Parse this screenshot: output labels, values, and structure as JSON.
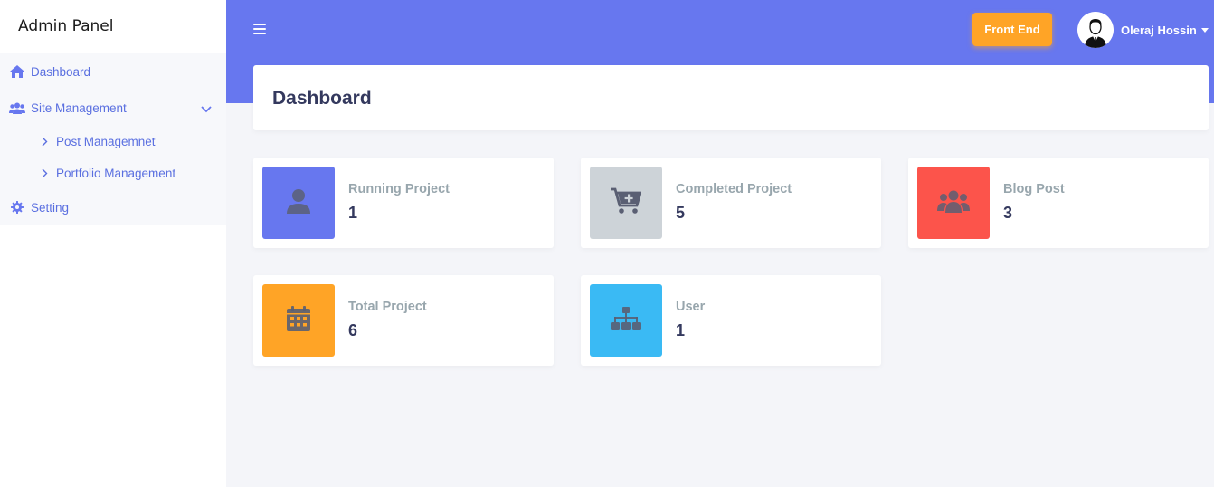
{
  "sidebar": {
    "brand": "Admin Panel",
    "items": [
      {
        "label": "Dashboard",
        "icon": "home-icon"
      },
      {
        "label": "Site Management",
        "icon": "users-icon"
      },
      {
        "label": "Setting",
        "icon": "gear-icon"
      }
    ],
    "subitems": [
      {
        "label": "Post Managemnet"
      },
      {
        "label": "Portfolio Management"
      }
    ]
  },
  "topbar": {
    "frontend_label": "Front End",
    "user_name": "Oleraj Hossin"
  },
  "page": {
    "title": "Dashboard"
  },
  "cards": [
    {
      "label": "Running Project",
      "value": "1",
      "color": "#6777ef",
      "icon": "user-icon"
    },
    {
      "label": "Completed Project",
      "value": "5",
      "color": "#cdd3d8",
      "icon": "cart-plus-icon"
    },
    {
      "label": "Blog Post",
      "value": "3",
      "color": "#fc544b",
      "icon": "users-icon"
    },
    {
      "label": "Total Project",
      "value": "6",
      "color": "#ffa426",
      "icon": "calendar-icon"
    },
    {
      "label": "User",
      "value": "1",
      "color": "#3abaf4",
      "icon": "sitemap-icon"
    }
  ],
  "colors": {
    "primary": "#6777ef",
    "sidebar_text": "#5a6fe0",
    "background": "#f4f5f9"
  }
}
